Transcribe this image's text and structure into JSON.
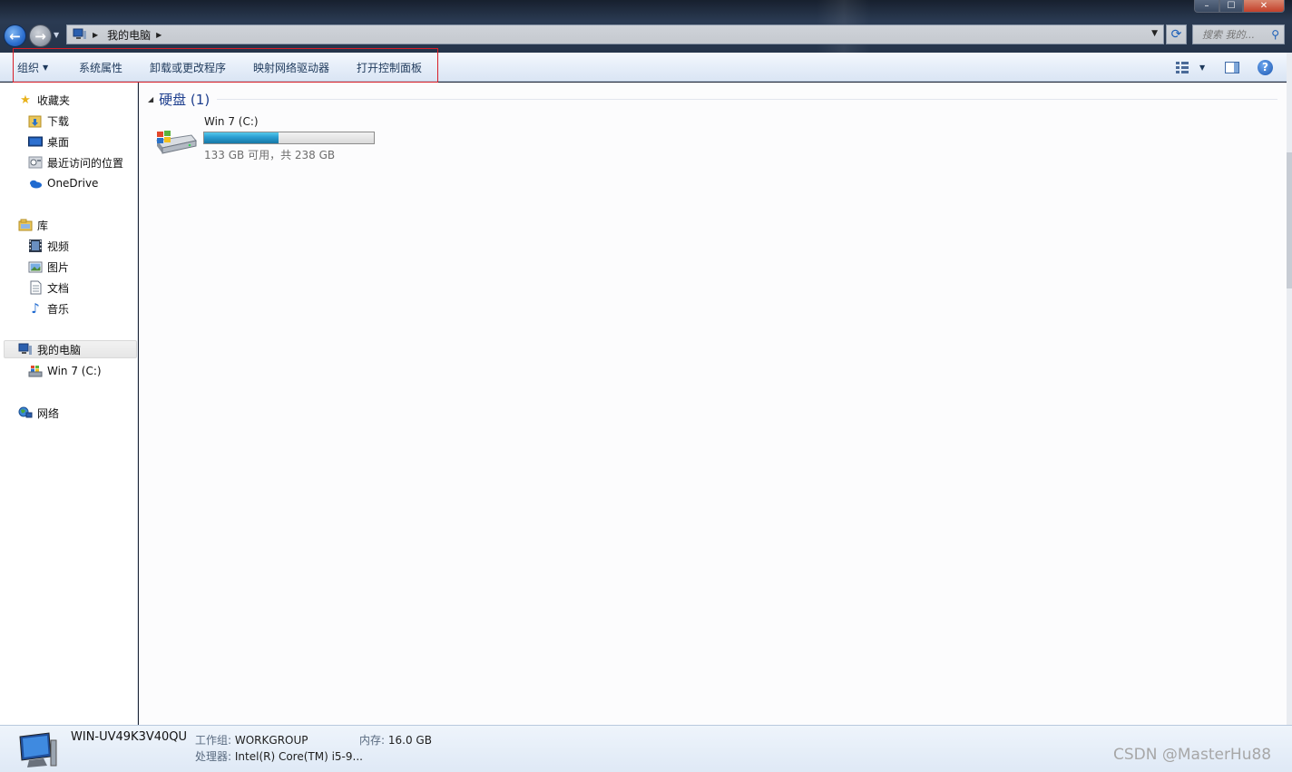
{
  "window": {
    "min_glyph": "–",
    "max_glyph": "☐",
    "close_glyph": "✕"
  },
  "address": {
    "crumb": "我的电脑",
    "search_placeholder": "搜索 我的..."
  },
  "toolbar": {
    "organize": "组织",
    "system_properties": "系统属性",
    "uninstall": "卸载或更改程序",
    "map_drive": "映射网络驱动器",
    "control_panel": "打开控制面板"
  },
  "nav": {
    "favorites": "收藏夹",
    "downloads": "下载",
    "desktop": "桌面",
    "recent": "最近访问的位置",
    "onedrive": "OneDrive",
    "libraries": "库",
    "videos": "视频",
    "pictures": "图片",
    "documents": "文档",
    "music": "音乐",
    "computer": "我的电脑",
    "drive_c": "Win 7 (C:)",
    "network": "网络"
  },
  "content": {
    "group_title": "硬盘 (1)",
    "drive": {
      "name": "Win 7 (C:)",
      "space_text": "133 GB 可用，共 238 GB",
      "used_fraction": 0.441
    }
  },
  "details": {
    "pc_name": "WIN-UV49K3V40QU",
    "workgroup_label": "工作组:",
    "workgroup_value": "WORKGROUP",
    "memory_label": "内存:",
    "memory_value": "16.0 GB",
    "cpu_label": "处理器:",
    "cpu_value": "Intel(R) Core(TM) i5-9..."
  },
  "watermark": "CSDN @MasterHu88",
  "colors": {
    "accent": "#1e3f8e",
    "highlight_box": "#d81e28",
    "usage_bar": "#2a9dd1"
  }
}
